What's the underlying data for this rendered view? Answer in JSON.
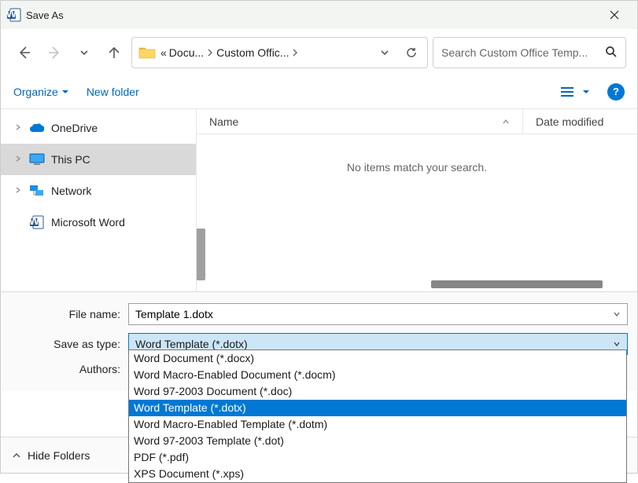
{
  "titlebar": {
    "title": "Save As"
  },
  "address": {
    "truncator": "«",
    "crumb1": "Docu...",
    "crumb2": "Custom Offic..."
  },
  "search": {
    "placeholder": "Search Custom Office Temp..."
  },
  "toolbar": {
    "organize": "Organize",
    "new_folder": "New folder"
  },
  "tree": {
    "onedrive": "OneDrive",
    "this_pc": "This PC",
    "network": "Network",
    "word": "Microsoft Word"
  },
  "columns": {
    "name": "Name",
    "date": "Date modified"
  },
  "filelist": {
    "empty": "No items match your search."
  },
  "form": {
    "filename_label": "File name:",
    "filename_value": "Template 1.dotx",
    "savetype_label": "Save as type:",
    "savetype_value": "Word Template (*.dotx)",
    "authors_label": "Authors:"
  },
  "type_options": [
    "Word Document (*.docx)",
    "Word Macro-Enabled Document (*.docm)",
    "Word 97-2003 Document (*.doc)",
    "Word Template (*.dotx)",
    "Word Macro-Enabled Template (*.dotm)",
    "Word 97-2003 Template (*.dot)",
    "PDF (*.pdf)",
    "XPS Document (*.xps)"
  ],
  "footer": {
    "hide_folders": "Hide Folders"
  }
}
